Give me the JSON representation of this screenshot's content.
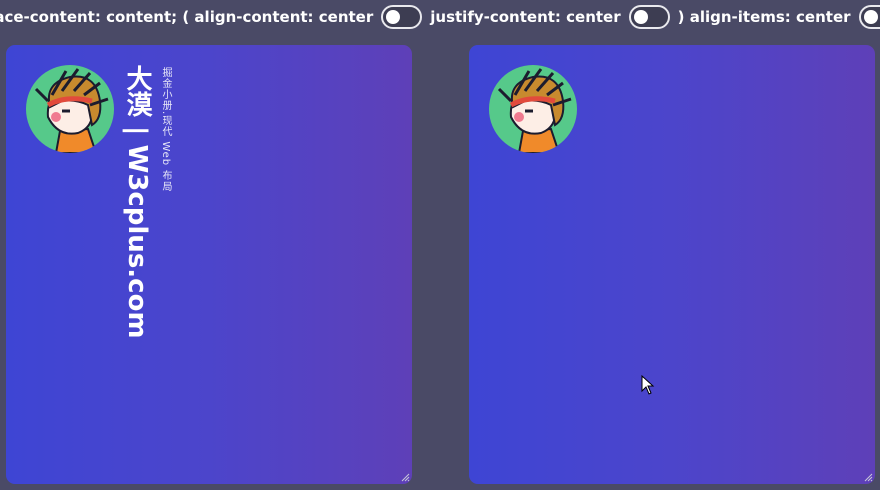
{
  "toolbar": {
    "label_place_content": "place-content: content; ( align-content: center",
    "label_justify_content": "justify-content: center",
    "label_align_items": ") align-items: center"
  },
  "left_panel": {
    "title": "大漠 | W3cplus.com",
    "subtitle": "掘金小册.现代 Web 布局"
  },
  "colors": {
    "page_bg": "#4a4a66",
    "panel_gradient_start": "#3e45d4",
    "panel_gradient_end": "#5e40b8",
    "avatar_ring": "#56c98a"
  },
  "icons": [
    "avatar-illustration",
    "mouse-pointer-icon",
    "resize-grip-icon"
  ]
}
